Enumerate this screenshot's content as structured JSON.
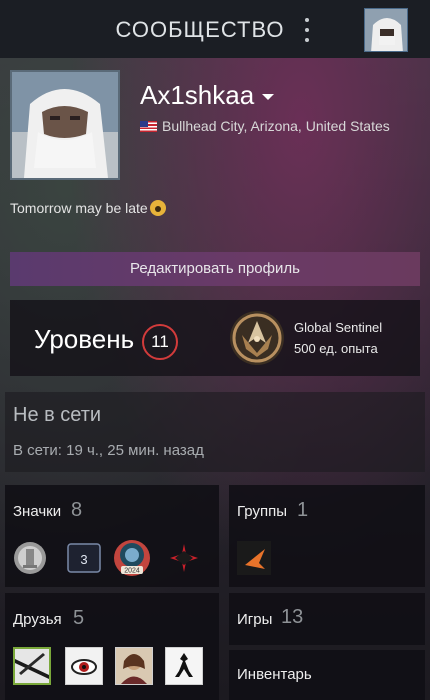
{
  "header": {
    "title": "СООБЩЕСТВО"
  },
  "profile": {
    "persona_name": "Ax1shkaa",
    "location": "Bullhead City, Arizona, United States",
    "summary": "Tomorrow may be late",
    "edit_button": "Редактировать профиль"
  },
  "level": {
    "label": "Уровень",
    "value": "11",
    "badge_name": "Global Sentinel",
    "badge_xp": "500 ед. опыта"
  },
  "status": {
    "title": "Не в сети",
    "last_online": "В сети: 19 ч., 25 мин. назад"
  },
  "badges": {
    "label": "Значки",
    "count": "8",
    "items": [
      "pillar-badge-icon",
      "level-3-badge-icon",
      "steam-2024-badge-icon",
      "hitman-badge-icon"
    ],
    "level_badge_text": "3",
    "steam_badge_year": "2024"
  },
  "groups": {
    "label": "Группы",
    "count": "1"
  },
  "friends": {
    "label": "Друзья",
    "count": "5"
  },
  "games": {
    "label": "Игры",
    "count": "13"
  },
  "inventory": {
    "label": "Инвентарь"
  },
  "colors": {
    "level_ring": "#d23b3b",
    "edit_button": "#5a3a6e",
    "friend_online_border": "#7aa83a"
  }
}
